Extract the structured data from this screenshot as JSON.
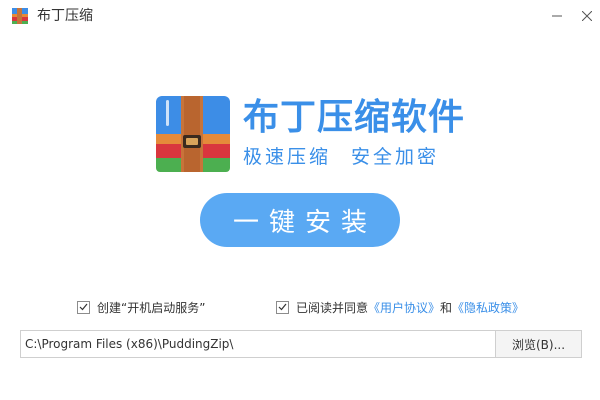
{
  "window": {
    "title": "布丁压缩",
    "minimize_icon": "minimize-icon",
    "close_icon": "close-icon"
  },
  "logo": {
    "icon": "suitcase-archive-icon",
    "product_name": "布丁压缩软件",
    "tagline_left": "极速压缩",
    "tagline_right": "安全加密"
  },
  "install_button": {
    "label": "一键安装"
  },
  "options": {
    "autostart": {
      "label": "创建“开机启动服务”",
      "checked": true
    },
    "agreement": {
      "prefix": "已阅读并同意",
      "user_agreement": "《用户协议》",
      "conjunction": "和",
      "privacy_policy": "《隐私政策》",
      "checked": true
    }
  },
  "install_path": {
    "value": "C:\\Program Files (x86)\\PuddingZip\\",
    "browse_label": "浏览(B)..."
  },
  "colors": {
    "accent": "#3a8fe8",
    "button": "#5aa9f3",
    "logo_blue": "#3d8de6",
    "logo_orange": "#e58a3a",
    "logo_red": "#d9363e",
    "logo_green": "#4caf50"
  }
}
